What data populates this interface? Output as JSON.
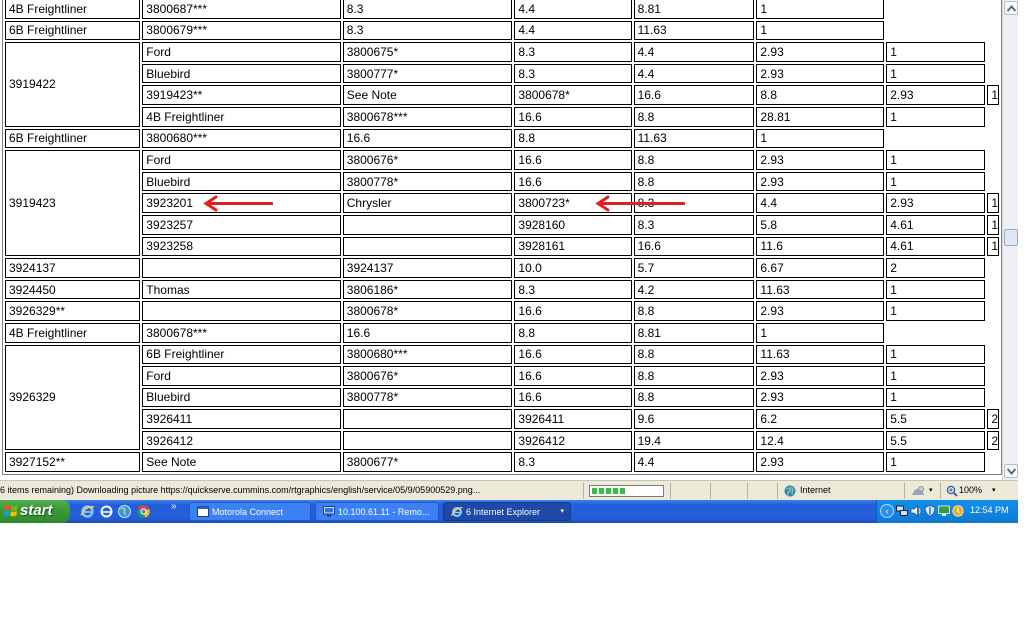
{
  "table": {
    "rows": [
      {
        "pn": "",
        "app": "4B Freightliner",
        "ref": "3800687***",
        "c1": "8.3",
        "c2": "4.4",
        "c3": "8.81",
        "qty": "1"
      },
      {
        "pn": "",
        "app": "6B Freightliner",
        "ref": "3800679***",
        "c1": "8.3",
        "c2": "4.4",
        "c3": "11.63",
        "qty": "1"
      },
      {
        "pn": "3919422",
        "app": "Ford",
        "ref": "3800675*",
        "c1": "8.3",
        "c2": "4.4",
        "c3": "2.93",
        "qty": "1"
      },
      {
        "pn": "",
        "app": "Bluebird",
        "ref": "3800777*",
        "c1": "8.3",
        "c2": "4.4",
        "c3": "2.93",
        "qty": "1"
      },
      {
        "pn": "3919423**",
        "app": "See Note",
        "ref": "3800678*",
        "c1": "16.6",
        "c2": "8.8",
        "c3": "2.93",
        "qty": "1"
      },
      {
        "pn": "",
        "app": "4B Freightliner",
        "ref": "3800678***",
        "c1": "16.6",
        "c2": "8.8",
        "c3": "28.81",
        "qty": "1"
      },
      {
        "pn": "",
        "app": "6B Freightliner",
        "ref": "3800680***",
        "c1": "16.6",
        "c2": "8.8",
        "c3": "11.63",
        "qty": "1"
      },
      {
        "pn": "3919423",
        "app": "Ford",
        "ref": "3800676*",
        "c1": "16.6",
        "c2": "8.8",
        "c3": "2.93",
        "qty": "1"
      },
      {
        "pn": "",
        "app": "Bluebird",
        "ref": "3800778*",
        "c1": "16.6",
        "c2": "8.8",
        "c3": "2.93",
        "qty": "1"
      },
      {
        "pn": "3923201",
        "app": "Chrysler",
        "ref": "3800723*",
        "c1": "8.3",
        "c2": "4.4",
        "c3": "2.93",
        "qty": "1"
      },
      {
        "pn": "3923257",
        "app": "",
        "ref": "3928160",
        "c1": "8.3",
        "c2": "5.8",
        "c3": "4.61",
        "qty": "1"
      },
      {
        "pn": "3923258",
        "app": "",
        "ref": "3928161",
        "c1": "16.6",
        "c2": "11.6",
        "c3": "4.61",
        "qty": "1"
      },
      {
        "pn": "3924137",
        "app": "",
        "ref": "3924137",
        "c1": "10.0",
        "c2": "5.7",
        "c3": "6.67",
        "qty": "2"
      },
      {
        "pn": "3924450",
        "app": "Thomas",
        "ref": "3806186*",
        "c1": "8.3",
        "c2": "4.2",
        "c3": "11.63",
        "qty": "1"
      },
      {
        "pn": "3926329**",
        "app": "",
        "ref": "3800678*",
        "c1": "16.6",
        "c2": "8.8",
        "c3": "2.93",
        "qty": "1"
      },
      {
        "pn": "",
        "app": "4B Freightliner",
        "ref": "3800678***",
        "c1": "16.6",
        "c2": "8.8",
        "c3": "8.81",
        "qty": "1"
      },
      {
        "pn": "3926329",
        "app": "6B Freightliner",
        "ref": "3800680***",
        "c1": "16.6",
        "c2": "8.8",
        "c3": "11.63",
        "qty": "1"
      },
      {
        "pn": "",
        "app": "Ford",
        "ref": "3800676*",
        "c1": "16.6",
        "c2": "8.8",
        "c3": "2.93",
        "qty": "1"
      },
      {
        "pn": "",
        "app": "Bluebird",
        "ref": "3800778*",
        "c1": "16.6",
        "c2": "8.8",
        "c3": "2.93",
        "qty": "1"
      },
      {
        "pn": "3926411",
        "app": "",
        "ref": "3926411",
        "c1": "9.6",
        "c2": "6.2",
        "c3": "5.5",
        "qty": "2"
      },
      {
        "pn": "3926412",
        "app": "",
        "ref": "3926412",
        "c1": "19.4",
        "c2": "12.4",
        "c3": "5.5",
        "qty": "2"
      },
      {
        "pn": "3927152**",
        "app": "See Note",
        "ref": "3800677*",
        "c1": "8.3",
        "c2": "4.4",
        "c3": "2.93",
        "qty": "1"
      }
    ]
  },
  "annotation": {
    "arrow_color": "#e02020"
  },
  "statusbar": {
    "text": "6 items remaining) Downloading picture https://quickserve.cummins.com/rtgraphics/english/service/05/9/05900529.png...",
    "progress_fraction": 0.5,
    "progress_color": "#2fc23a",
    "zone_label": "Internet",
    "zoom_label": "100%",
    "zoom_chevron": "▾",
    "protect_chevron": "▾"
  },
  "taskbar": {
    "start_label": "start",
    "quick_launch": [
      "ie-icon",
      "ie-alt-icon",
      "globe-icon",
      "chrome-icon"
    ],
    "quick_launch_more": "»",
    "tasks": [
      {
        "label": "Motorola Connect",
        "icon": "window-icon"
      },
      {
        "label": "10.100.61.11 - Remo...",
        "icon": "remote-desktop-icon"
      },
      {
        "label": "6 Internet Explorer",
        "icon": "ie-icon",
        "chevron": "▾"
      }
    ],
    "tray_toggle": "‹",
    "clock": "12:54 PM"
  },
  "colors": {
    "taskbar_blue": "#245edb",
    "start_green": "#3b9a38",
    "tray_blue": "#0f79d5",
    "status_gray": "#ece9d8"
  }
}
